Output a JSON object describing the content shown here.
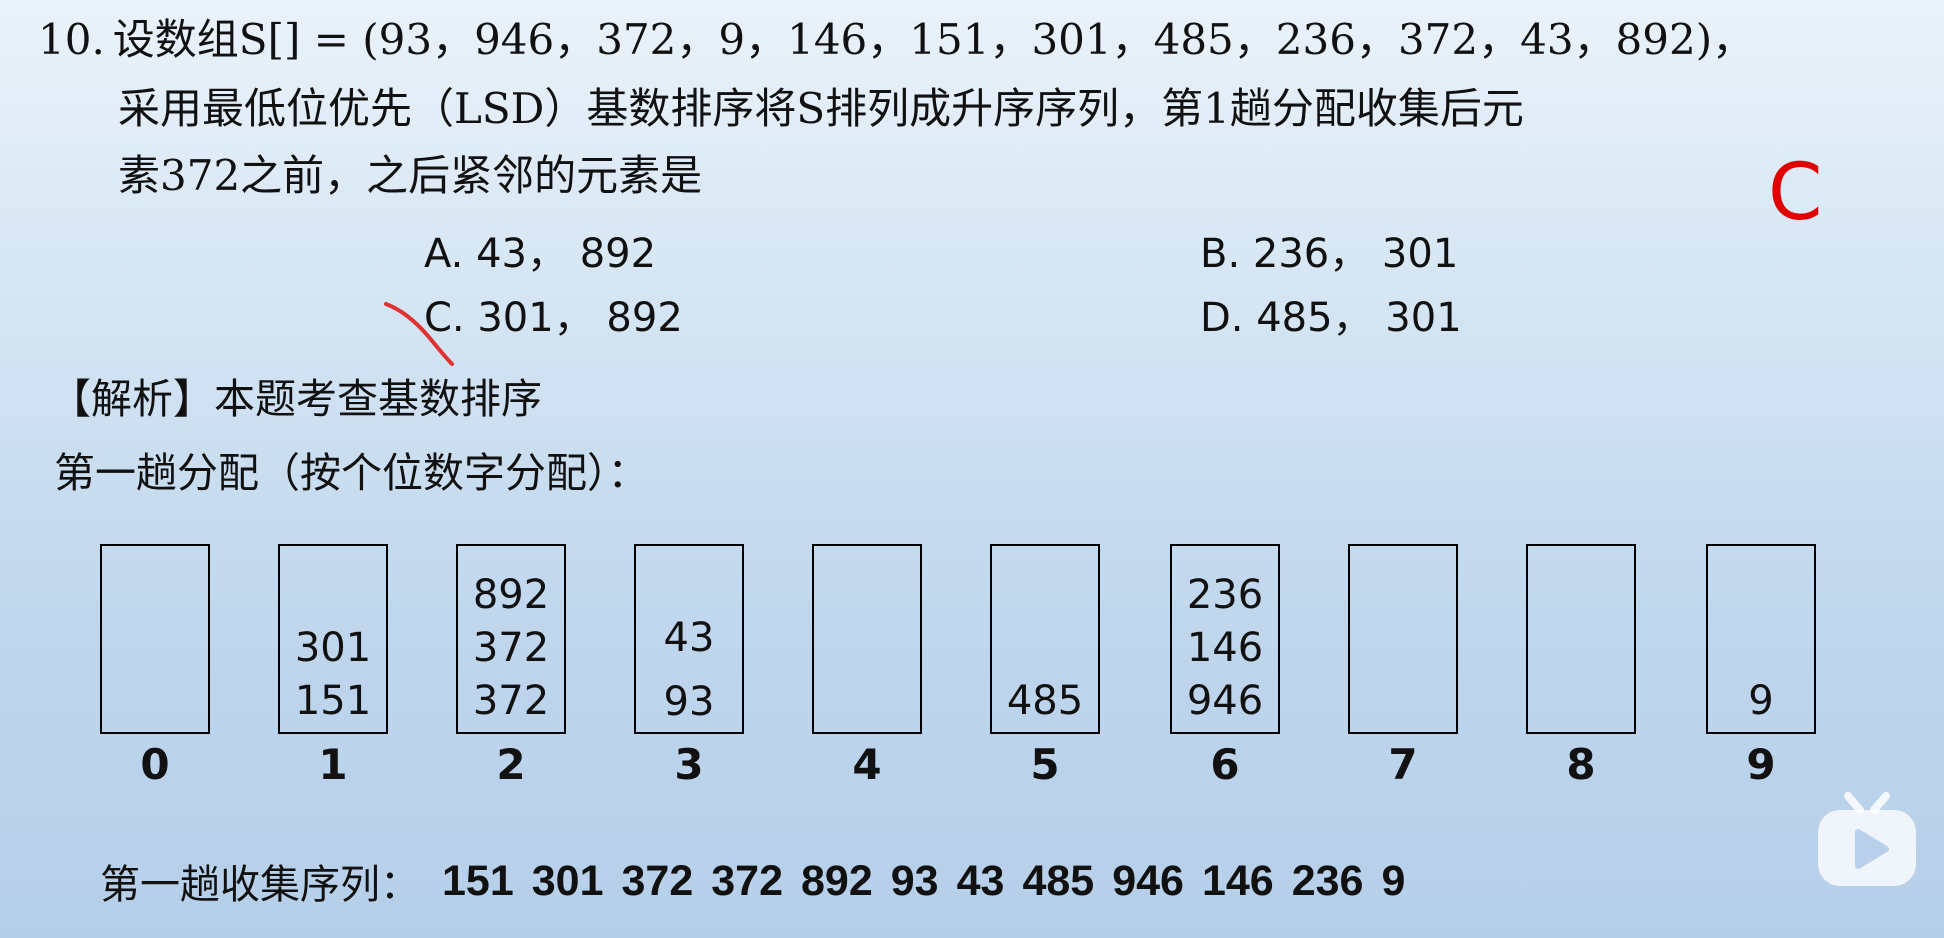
{
  "question": {
    "number": "10.",
    "line1": "设数组S[] = (93，946，372，9，146，151，301，485，236，372，43，892)，",
    "line2": "采用最低位优先（LSD）基数排序将S排列成升序序列，第1趟分配收集后元",
    "line3": "素372之前，之后紧邻的元素是"
  },
  "answer_mark": "C",
  "options": {
    "a": "A. 43， 892",
    "b": "B. 236， 301",
    "c": "C. 301， 892",
    "d": "D. 485， 301"
  },
  "analysis": {
    "heading": "【解析】本题考查基数排序",
    "pass1_title": "第一趟分配（按个位数字分配）："
  },
  "buckets": [
    {
      "index": "0",
      "items": []
    },
    {
      "index": "1",
      "items": [
        "301",
        "151"
      ]
    },
    {
      "index": "2",
      "items": [
        "892",
        "372",
        "372"
      ]
    },
    {
      "index": "3",
      "items": [
        "43",
        "93"
      ]
    },
    {
      "index": "4",
      "items": []
    },
    {
      "index": "5",
      "items": [
        "485"
      ]
    },
    {
      "index": "6",
      "items": [
        "236",
        "146",
        "946"
      ]
    },
    {
      "index": "7",
      "items": []
    },
    {
      "index": "8",
      "items": []
    },
    {
      "index": "9",
      "items": [
        "9"
      ]
    }
  ],
  "collect": {
    "label": "第一趟收集序列：",
    "values": [
      "151",
      "301",
      "372",
      "372",
      "892",
      "93",
      "43",
      "485",
      "946",
      "146",
      "236",
      "9"
    ]
  },
  "colors": {
    "answer": "#e00000",
    "watermark": "#ffffff"
  },
  "icons": {
    "play": "play-icon",
    "tick": "check-mark-icon"
  }
}
